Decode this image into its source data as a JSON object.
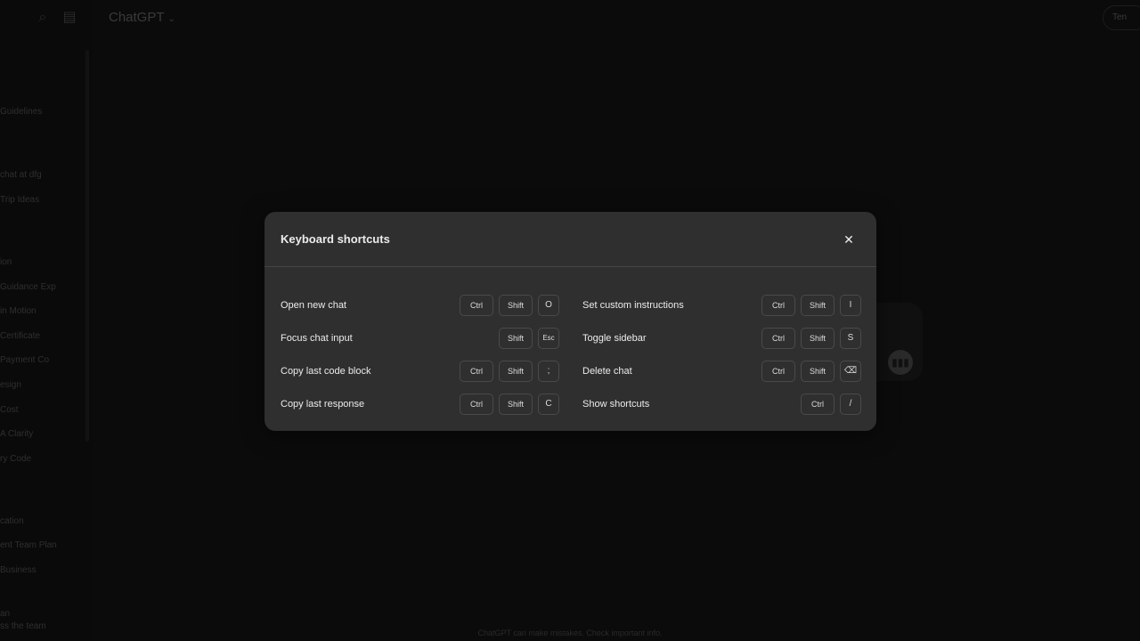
{
  "app": {
    "title": "ChatGPT",
    "title_chevron": "⌄",
    "top_right_button": "Ten",
    "footer_note": "ChatGPT can make mistakes. Check important info."
  },
  "sidebar": {
    "items": [
      {
        "label": "Guidelines"
      },
      {
        "label": "chat at dfg"
      },
      {
        "label": "Trip Ideas"
      },
      {
        "label": "ion"
      },
      {
        "label": "Guidance Exp"
      },
      {
        "label": "in Motion"
      },
      {
        "label": "Certificate"
      },
      {
        "label": "Payment Co"
      },
      {
        "label": "esign"
      },
      {
        "label": "Cost"
      },
      {
        "label": "A Clarity"
      },
      {
        "label": "ry Code"
      },
      {
        "label": "cation"
      },
      {
        "label": "ent Team Plan"
      },
      {
        "label": "Business"
      },
      {
        "label": "an"
      },
      {
        "label": "ss the team"
      }
    ]
  },
  "modal": {
    "title": "Keyboard shortcuts",
    "close_icon": "✕",
    "left_shortcuts": [
      {
        "label": "Open new chat",
        "keys": [
          "Ctrl",
          "Shift",
          "O"
        ]
      },
      {
        "label": "Focus chat input",
        "keys": [
          "Shift",
          "Esc"
        ]
      },
      {
        "label": "Copy last code block",
        "keys": [
          "Ctrl",
          "Shift",
          ";"
        ]
      },
      {
        "label": "Copy last response",
        "keys": [
          "Ctrl",
          "Shift",
          "C"
        ]
      }
    ],
    "right_shortcuts": [
      {
        "label": "Set custom instructions",
        "keys": [
          "Ctrl",
          "Shift",
          "I"
        ]
      },
      {
        "label": "Toggle sidebar",
        "keys": [
          "Ctrl",
          "Shift",
          "S"
        ]
      },
      {
        "label": "Delete chat",
        "keys": [
          "Ctrl",
          "Shift",
          "⌫"
        ]
      },
      {
        "label": "Show shortcuts",
        "keys": [
          "Ctrl",
          "/"
        ]
      }
    ]
  },
  "icons": {
    "search": "search-icon",
    "sidebar_toggle": "sidebar-toggle-icon",
    "voice": "voice-icon",
    "close": "close-icon"
  },
  "colors": {
    "background": "#0b0b0b",
    "modal_bg": "#2f2f2f",
    "modal_divider": "#444444",
    "key_border": "#4a4a4a",
    "text": "#ececec"
  }
}
